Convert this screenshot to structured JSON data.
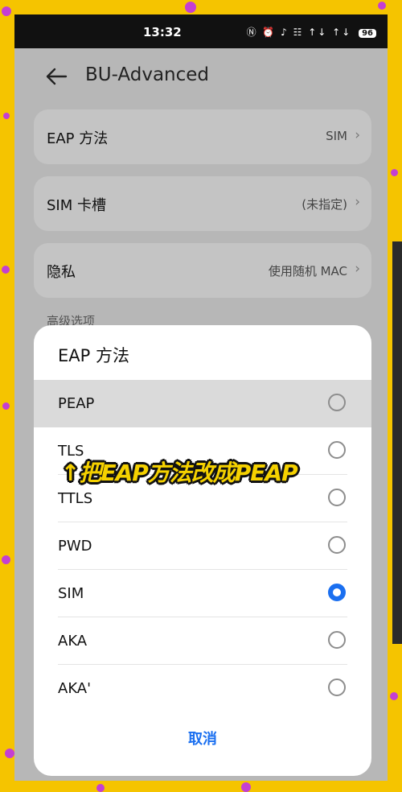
{
  "status_bar": {
    "time": "13:32",
    "icons": "Ⓝ ⏰ ♪ ☷ ↑↓ ↑↓",
    "battery": "96"
  },
  "header": {
    "title": "BU-Advanced"
  },
  "settings": [
    {
      "label": "EAP 方法",
      "value": "SIM"
    },
    {
      "label": "SIM 卡槽",
      "value": "(未指定)"
    },
    {
      "label": "隐私",
      "value": "使用随机 MAC"
    }
  ],
  "section_label": "高级选项",
  "dialog": {
    "title": "EAP 方法",
    "options": [
      {
        "label": "PEAP",
        "selected": false,
        "highlighted": true
      },
      {
        "label": "TLS",
        "selected": false,
        "highlighted": false
      },
      {
        "label": "TTLS",
        "selected": false,
        "highlighted": false
      },
      {
        "label": "PWD",
        "selected": false,
        "highlighted": false
      },
      {
        "label": "SIM",
        "selected": true,
        "highlighted": false
      },
      {
        "label": "AKA",
        "selected": false,
        "highlighted": false
      },
      {
        "label": "AKA'",
        "selected": false,
        "highlighted": false
      }
    ],
    "cancel_label": "取消"
  },
  "overlay_caption": "↑把EAP方法改成PEAP",
  "colors": {
    "accent": "#1a6ff0",
    "backdrop": "#f5c400",
    "dots": "#c43fd2"
  }
}
